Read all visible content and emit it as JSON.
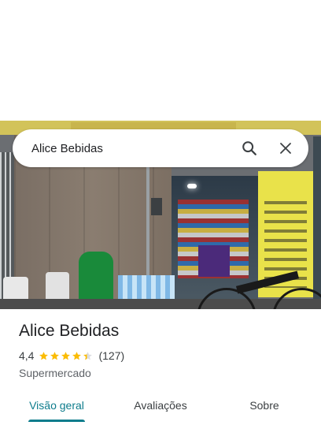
{
  "search": {
    "query": "Alice Bebidas",
    "search_icon": "search-icon",
    "close_icon": "close-icon"
  },
  "place": {
    "name": "Alice Bebidas",
    "rating": "4,4",
    "rating_value": 4.4,
    "review_count": "(127)",
    "category": "Supermercado"
  },
  "tabs": [
    {
      "label": "Visão geral",
      "active": true
    },
    {
      "label": "Avaliações",
      "active": false
    },
    {
      "label": "Sobre",
      "active": false
    }
  ],
  "colors": {
    "accent": "#0d7c8c",
    "star": "#fbbc04",
    "star_empty": "#dadce0"
  }
}
